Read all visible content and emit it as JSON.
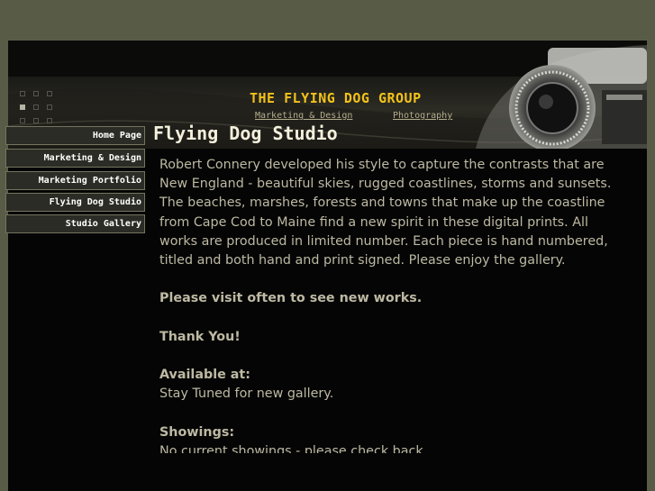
{
  "header": {
    "site_title": "THE FLYING DOG GROUP",
    "links": [
      "Marketing & Design",
      "Photography"
    ]
  },
  "nav": {
    "items": [
      {
        "label": "Home Page"
      },
      {
        "label": "Marketing & Design"
      },
      {
        "label": "Marketing Portfolio"
      },
      {
        "label": "Flying Dog Studio"
      },
      {
        "label": "Studio Gallery"
      }
    ]
  },
  "main": {
    "title": "Flying Dog Studio",
    "intro": "Robert Connery developed his style to capture the contrasts that are New England - beautiful skies, rugged coastlines, storms and sunsets. The beaches, marshes, forests and towns that make up the coastline from Cape Cod to Maine find a new spirit in these digital prints.  All works are produced in limited number. Each piece is hand numbered, titled and both hand and print signed.  Please enjoy the gallery.",
    "visit": "Please visit often to see new works.",
    "thanks": "Thank You!",
    "available_heading": "Available at:",
    "available_text": "Stay Tuned for new gallery.",
    "showings_heading": "Showings:",
    "showings_text": "No current showings - please check back"
  },
  "colors": {
    "page_bg": "#585c47",
    "title_gold": "#f2c21a",
    "body_text": "#bdb9a3"
  },
  "icons": [
    "camera-lens-image",
    "grid-dots-icon"
  ]
}
